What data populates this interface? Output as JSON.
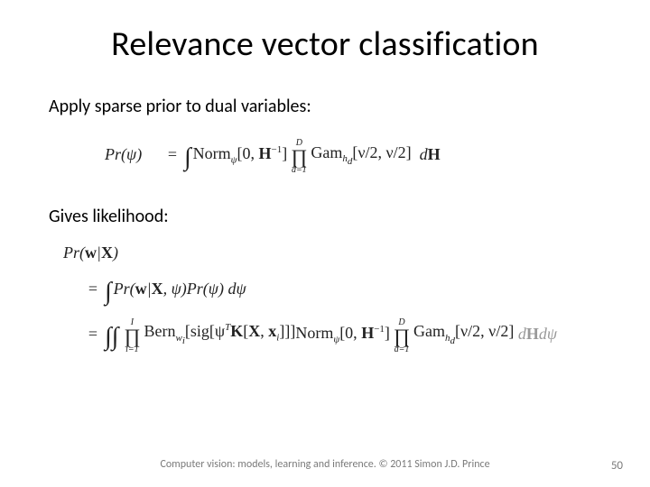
{
  "title": "Relevance vector classification",
  "line1": "Apply sparse prior to dual variables:",
  "line2": "Gives likelihood:",
  "eq1": {
    "lhs": "Pr(ψ)",
    "op": "=",
    "int": "∫",
    "norm_name": "Norm",
    "norm_sub": "ψ",
    "norm_arg": "[0, H⁻¹]",
    "prod_top": "D",
    "prod_bot": "d=1",
    "gam_name": "Gam",
    "gam_sub": "h_d",
    "gam_arg": "[ν/2, ν/2]",
    "diff": "dH"
  },
  "eq2a": {
    "lhs": "Pr(w|X)",
    "op": "=",
    "int": "∫",
    "part1": "Pr(w|X, ψ)Pr(ψ)",
    "diff": "dψ"
  },
  "eq2b": {
    "op": "=",
    "int2": "∫∫",
    "prod1_top": "I",
    "prod1_bot": "i=1",
    "bern_name": "Bern",
    "bern_sub": "w_i",
    "bern_arg_pre": "[sig[ψ",
    "bern_arg_mid": "K[X, x",
    "bern_arg_suf": "]]]",
    "norm_name": "Norm",
    "norm_sub": "ψ",
    "norm_arg": "[0, H⁻¹]",
    "prod2_top": "D",
    "prod2_bot": "d=1",
    "gam_name": "Gam",
    "gam_sub": "h_d",
    "gam_arg": "[ν/2, ν/2]",
    "diff": "dHdψ"
  },
  "footer": "Computer vision: models, learning and inference.  © 2011 Simon J.D. Prince",
  "pagenum": "50"
}
